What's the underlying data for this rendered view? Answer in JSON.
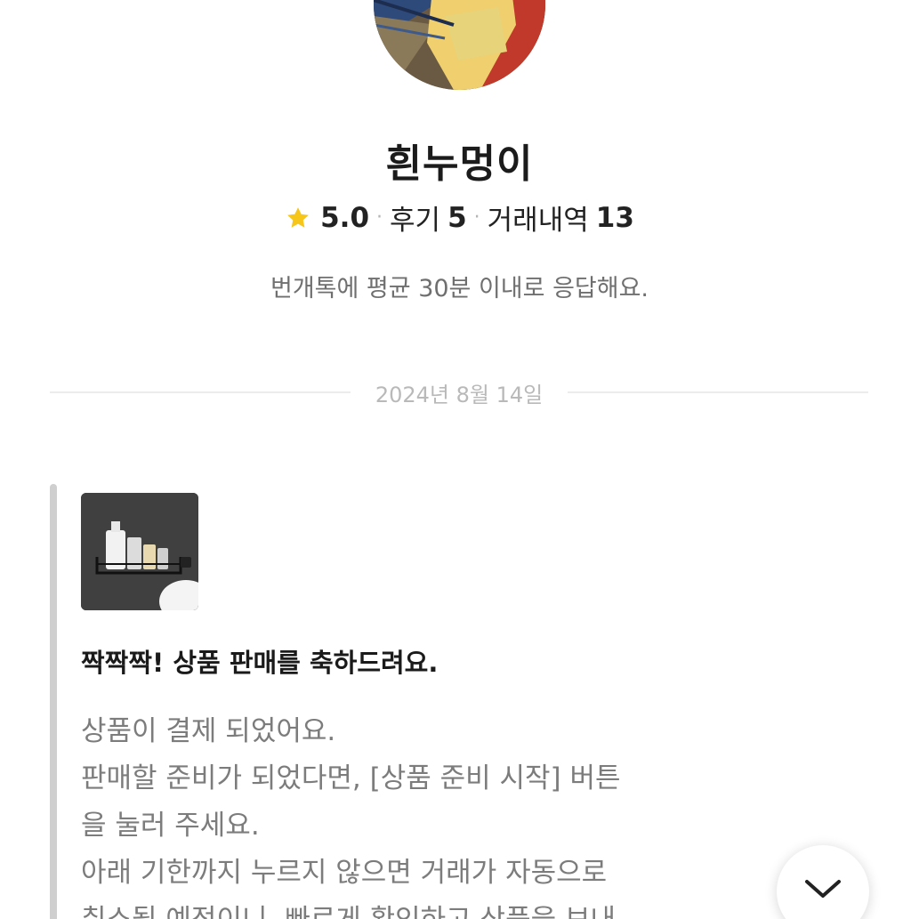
{
  "profile": {
    "name": "흰누멍이",
    "rating": "5.0",
    "reviews_label": "후기",
    "reviews_count": "5",
    "trades_label": "거래내역",
    "trades_count": "13",
    "response_note": "번개톡에 평균 30분 이내로 응답해요."
  },
  "chat": {
    "date": "2024년 8월 14일",
    "message": {
      "title": "짝짝짝! 상품 판매를 축하드려요.",
      "lines": [
        "상품이 결제 되었어요.",
        "판매할 준비가 되었다면, [상품 준비 시작] 버튼",
        "을 눌러 주세요.",
        "아래 기한까지 누르지 않으면 거래가 자동으로",
        "취소될 예정이니, 빠르게 확인하고 상품을 보내"
      ]
    }
  },
  "icons": {
    "star": "star-icon",
    "scroll_down": "chevron-down-icon"
  },
  "colors": {
    "star": "#F7C61B",
    "muted_text": "#7C7C7C",
    "divider": "#ECECEC"
  }
}
